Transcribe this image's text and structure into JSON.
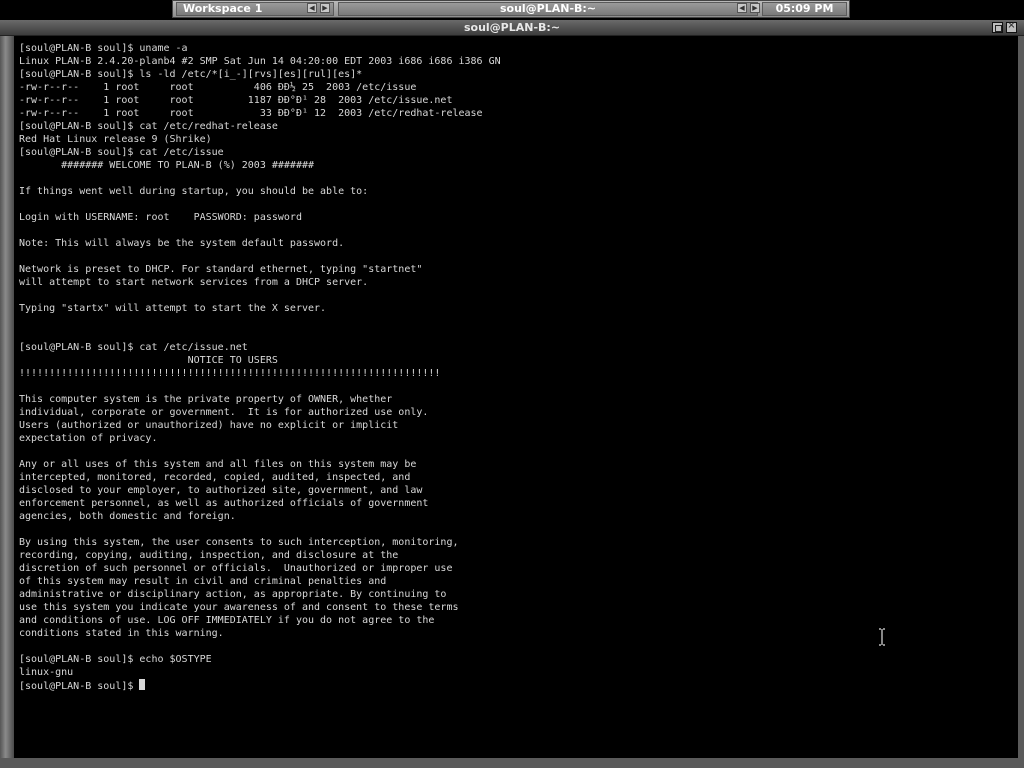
{
  "toolbar": {
    "workspace": "Workspace 1",
    "window_title": "soul@PLAN-B:~",
    "clock": "05:09 PM"
  },
  "window": {
    "title": "soul@PLAN-B:~"
  },
  "terminal": {
    "lines": [
      "[soul@PLAN-B soul]$ uname -a",
      "Linux PLAN-B 2.4.20-planb4 #2 SMP Sat Jun 14 04:20:00 EDT 2003 i686 i686 i386 GN",
      "[soul@PLAN-B soul]$ ls -ld /etc/*[i_-][rvs][es][rul][es]*",
      "-rw-r--r--    1 root     root          406 ĐĐ½ 25  2003 /etc/issue",
      "-rw-r--r--    1 root     root         1187 ĐĐ°Đ¹ 28  2003 /etc/issue.net",
      "-rw-r--r--    1 root     root           33 ĐĐ°Đ¹ 12  2003 /etc/redhat-release",
      "[soul@PLAN-B soul]$ cat /etc/redhat-release",
      "Red Hat Linux release 9 (Shrike)",
      "[soul@PLAN-B soul]$ cat /etc/issue",
      "       ####### WELCOME TO PLAN-B (%) 2003 #######",
      "",
      "If things went well during startup, you should be able to:",
      "",
      "Login with USERNAME: root    PASSWORD: password",
      "",
      "Note: This will always be the system default password.",
      "",
      "Network is preset to DHCP. For standard ethernet, typing \"startnet\"",
      "will attempt to start network services from a DHCP server.",
      "",
      "Typing \"startx\" will attempt to start the X server.",
      "",
      "",
      "[soul@PLAN-B soul]$ cat /etc/issue.net",
      "                            NOTICE TO USERS",
      "!!!!!!!!!!!!!!!!!!!!!!!!!!!!!!!!!!!!!!!!!!!!!!!!!!!!!!!!!!!!!!!!!!!!!!",
      "",
      "This computer system is the private property of OWNER, whether",
      "individual, corporate or government.  It is for authorized use only.",
      "Users (authorized or unauthorized) have no explicit or implicit",
      "expectation of privacy.",
      "",
      "Any or all uses of this system and all files on this system may be",
      "intercepted, monitored, recorded, copied, audited, inspected, and",
      "disclosed to your employer, to authorized site, government, and law",
      "enforcement personnel, as well as authorized officials of government",
      "agencies, both domestic and foreign.",
      "",
      "By using this system, the user consents to such interception, monitoring,",
      "recording, copying, auditing, inspection, and disclosure at the",
      "discretion of such personnel or officials.  Unauthorized or improper use",
      "of this system may result in civil and criminal penalties and",
      "administrative or disciplinary action, as appropriate. By continuing to",
      "use this system you indicate your awareness of and consent to these terms",
      "and conditions of use. LOG OFF IMMEDIATELY if you do not agree to the",
      "conditions stated in this warning.",
      "",
      "[soul@PLAN-B soul]$ echo $OSTYPE",
      "linux-gnu"
    ],
    "prompt": "[soul@PLAN-B soul]$ "
  }
}
